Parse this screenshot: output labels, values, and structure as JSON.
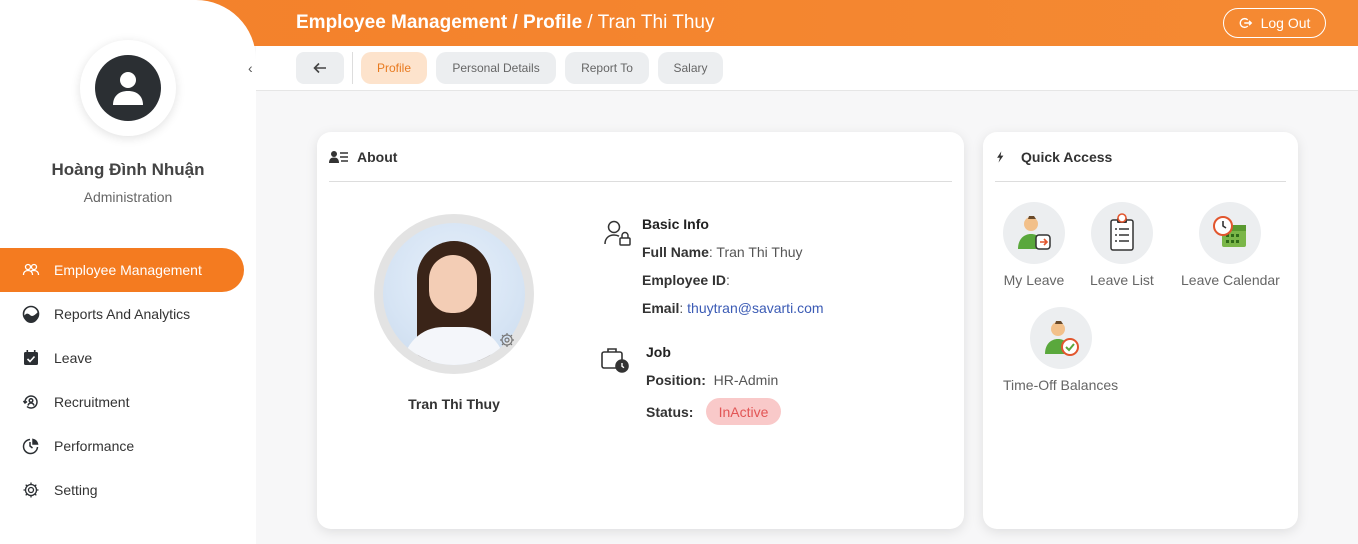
{
  "header": {
    "breadcrumb_1": "Employee Management / ",
    "breadcrumb_2": "Profile",
    "breadcrumb_3": " / Tran Thi Thuy",
    "logout_label": "Log Out"
  },
  "sidebar": {
    "user_name": "Hoàng Đình Nhuận",
    "user_role": "Administration",
    "collapse_glyph": "‹",
    "items": [
      {
        "label": "Employee Management",
        "icon": "users-icon"
      },
      {
        "label": "Reports And Analytics",
        "icon": "chart-icon"
      },
      {
        "label": "Leave",
        "icon": "calendar-check-icon"
      },
      {
        "label": "Recruitment",
        "icon": "recruit-icon"
      },
      {
        "label": "Performance",
        "icon": "performance-icon"
      },
      {
        "label": "Setting",
        "icon": "gear-icon"
      }
    ]
  },
  "tabs": [
    {
      "label": "Profile",
      "active": true
    },
    {
      "label": "Personal Details"
    },
    {
      "label": "Report To"
    },
    {
      "label": "Salary"
    }
  ],
  "about": {
    "title": "About",
    "employee_name": "Tran Thi Thuy",
    "basic_info_title": "Basic Info",
    "full_name_label": "Full Name",
    "full_name_value": ": Tran Thi Thuy",
    "employee_id_label": "Employee ID",
    "employee_id_value": ":",
    "email_label": "Email",
    "email_colon": ": ",
    "email_value": "thuytran@savarti.com",
    "job_title": "Job",
    "position_label": "Position:",
    "position_value": "HR-Admin",
    "status_label": "Status:",
    "status_value": "InActive"
  },
  "quick_access": {
    "title": "Quick Access",
    "items": [
      {
        "label": "My Leave",
        "icon": "my-leave-icon"
      },
      {
        "label": "Leave List",
        "icon": "leave-list-icon"
      },
      {
        "label": "Leave Calendar",
        "icon": "leave-calendar-icon"
      },
      {
        "label": "Time-Off Balances",
        "icon": "time-off-balances-icon"
      }
    ]
  },
  "colors": {
    "accent": "#f47b20",
    "status_bg": "#f9c9c9",
    "status_text": "#e25555",
    "link": "#3b5bb5"
  }
}
